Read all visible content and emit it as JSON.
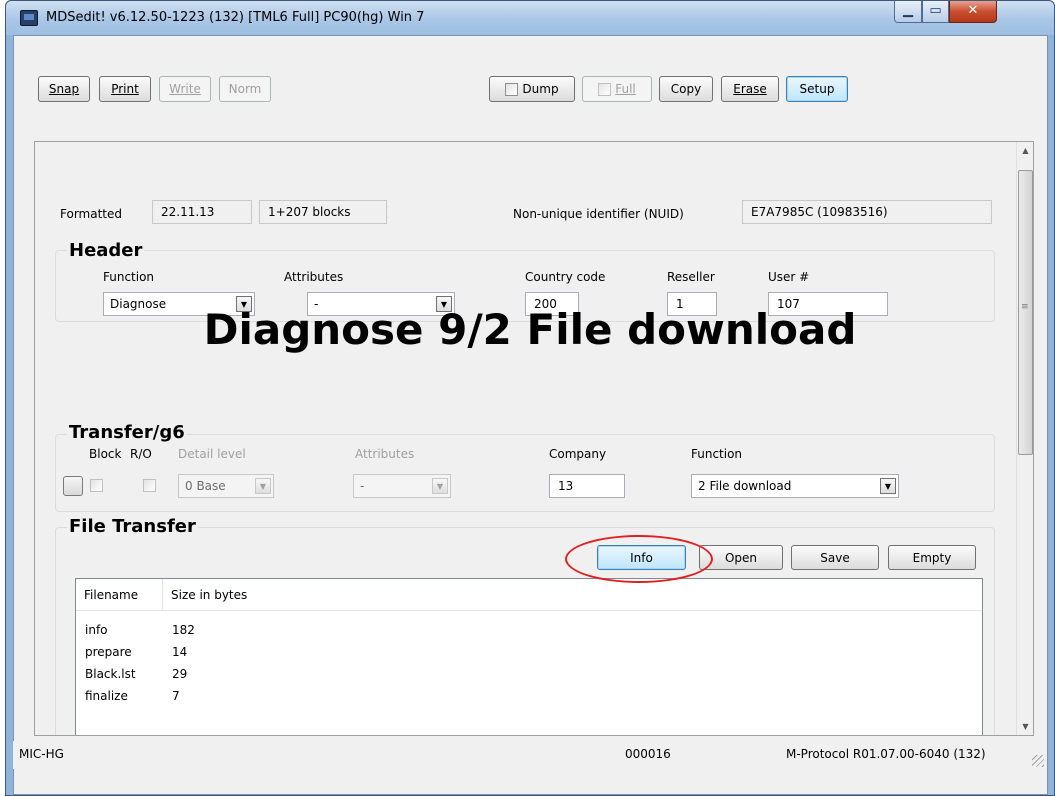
{
  "window": {
    "title": "MDSedit! v6.12.50-1223 (132) [TML6 Full] PC90(hg) Win 7",
    "min_glyph": "▁",
    "max_glyph": "▭",
    "close_glyph": "✕"
  },
  "toolbar": {
    "snap": "Snap",
    "print": "Print",
    "write": "Write",
    "norm": "Norm",
    "dump": "Dump",
    "full": "Full",
    "copy": "Copy",
    "erase": "Erase",
    "setup": "Setup"
  },
  "info_row": {
    "formatted_label": "Formatted",
    "formatted_date": "22.11.13",
    "blocks": "1+207 blocks",
    "nuid_label": "Non-unique identifier (NUID)",
    "nuid_value": "E7A7985C (10983516)"
  },
  "header": {
    "title": "Header",
    "function_label": "Function",
    "function_value": "Diagnose",
    "attributes_label": "Attributes",
    "attributes_value": "-",
    "country_label": "Country code",
    "country_value": "200",
    "reseller_label": "Reseller",
    "reseller_value": "1",
    "user_label": "User #",
    "user_value": "107"
  },
  "big_title": "Diagnose 9/2 File download",
  "transfer": {
    "title": "Transfer/g6",
    "block_label": "Block",
    "ro_label": "R/O",
    "detail_label": "Detail level",
    "detail_value": "0 Base",
    "attributes_label": "Attributes",
    "attributes_value": "-",
    "company_label": "Company",
    "company_value": "13",
    "function_label": "Function",
    "function_value": "2 File download"
  },
  "file_transfer": {
    "title": "File Transfer",
    "info_button": "Info",
    "open_button": "Open",
    "save_button": "Save",
    "empty_button": "Empty",
    "columns": [
      "Filename",
      "Size in bytes"
    ],
    "rows": [
      {
        "name": "info",
        "size": "182"
      },
      {
        "name": "prepare",
        "size": "14"
      },
      {
        "name": "Black.lst",
        "size": "29"
      },
      {
        "name": "finalize",
        "size": "7"
      }
    ]
  },
  "status_bar": {
    "left": "MIC-HG",
    "middle": "000016",
    "right": "M-Protocol R01.07.00-6040 (132)"
  },
  "colors": {
    "highlight_ring": "#e02020",
    "titlebar": "#a9c6e6",
    "close_button": "#c74f31"
  }
}
